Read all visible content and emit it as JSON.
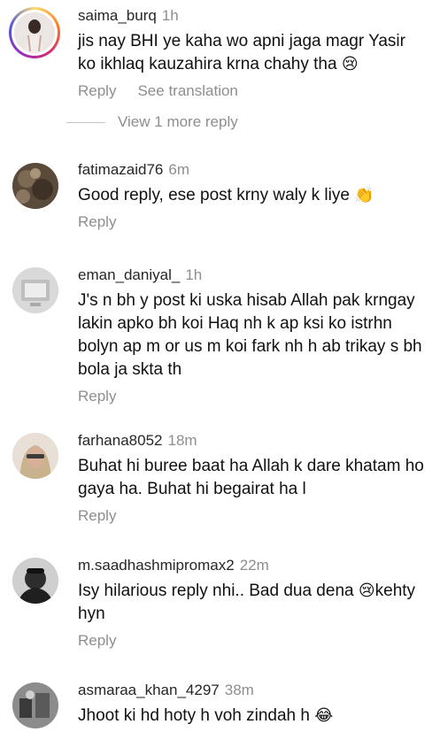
{
  "comments": [
    {
      "username": "saima_burq",
      "time": "1h",
      "text": "jis nay BHI ye kaha wo apni jaga magr Yasir ko ikhlaq kauzahira krna chahy tha",
      "emoji": "😢",
      "reply_label": "Reply",
      "translate_label": "See translation"
    },
    {
      "username": "fatimazaid76",
      "time": "6m",
      "text": "Good reply, ese post krny waly k liye",
      "emoji": "👏",
      "reply_label": "Reply"
    },
    {
      "username": "eman_daniyal_",
      "time": "1h",
      "text": "J's n bh y post ki uska hisab Allah pak krngay lakin apko bh koi Haq nh k ap ksi ko istrhn bolyn ap m or us m koi fark nh h ab trikay s bh bola ja skta th",
      "reply_label": "Reply"
    },
    {
      "username": "farhana8052",
      "time": "18m",
      "text": "Buhat hi buree baat ha Allah k dare khatam ho gaya ha. Buhat hi begairat ha l",
      "reply_label": "Reply"
    },
    {
      "username": "m.saadhashmipromax2",
      "time": "22m",
      "text_before": "Isy hilarious reply nhi.. Bad dua dena ",
      "emoji": "😢",
      "text_after": "kehty hyn",
      "reply_label": "Reply"
    },
    {
      "username": "asmaraa_khan_4297",
      "time": "38m",
      "text": "Jhoot ki hd hoty h voh zindah h",
      "emoji": "😂"
    }
  ],
  "view_more": "View 1 more reply"
}
